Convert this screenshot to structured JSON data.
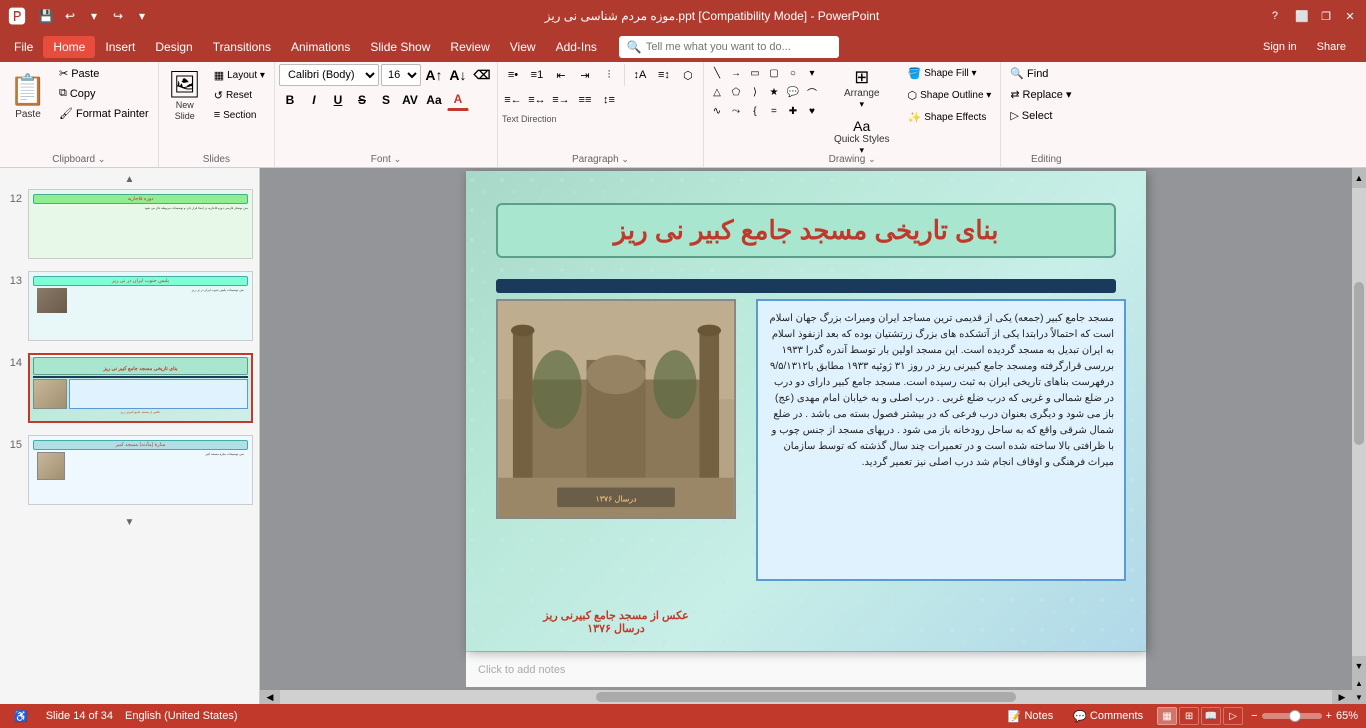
{
  "titlebar": {
    "title": "موزه مردم شناسی نی ریز.ppt [Compatibility Mode] - PowerPoint",
    "quickaccess": [
      "save",
      "undo",
      "redo",
      "customize"
    ]
  },
  "menubar": {
    "items": [
      "File",
      "Home",
      "Insert",
      "Design",
      "Transitions",
      "Animations",
      "Slide Show",
      "Review",
      "View",
      "Add-Ins"
    ],
    "active": "Home",
    "search_placeholder": "Tell me what you want to do...",
    "sign_in": "Sign in",
    "share": "Share"
  },
  "ribbon": {
    "groups": [
      {
        "name": "Clipboard",
        "label": "Clipboard",
        "items": [
          "Paste",
          "Cut",
          "Copy",
          "Format Painter"
        ]
      },
      {
        "name": "Slides",
        "label": "Slides",
        "items": [
          "New Slide",
          "Layout",
          "Reset",
          "Section"
        ]
      },
      {
        "name": "Font",
        "label": "Font",
        "font_name": "Calibri (Body)",
        "font_size": "16",
        "items": [
          "Bold",
          "Italic",
          "Underline",
          "Strikethrough",
          "Shadow",
          "Character Spacing",
          "Change Case",
          "Font Color"
        ]
      },
      {
        "name": "Paragraph",
        "label": "Paragraph",
        "items": [
          "Bullets",
          "Numbering",
          "Decrease Indent",
          "Increase Indent",
          "Align Left",
          "Center",
          "Align Right",
          "Justify",
          "Columns",
          "Text Direction",
          "Align Text",
          "Convert to SmartArt"
        ]
      },
      {
        "name": "Drawing",
        "label": "Drawing",
        "items": [
          "Arrange",
          "Quick Styles",
          "Shape Fill",
          "Shape Outline",
          "Shape Effects",
          "Select"
        ]
      },
      {
        "name": "Editing",
        "label": "Editing",
        "items": [
          "Find",
          "Replace",
          "Select"
        ]
      }
    ],
    "text_direction_label": "Text Direction",
    "align_text_label": "Align Text",
    "convert_smartart_label": "Convert to SmartArt",
    "section_label": "Section",
    "format_painter_label": "Format Painter",
    "copy_label": "Copy",
    "quick_styles_label": "Quick Styles",
    "shape_effects_label": "Shape Effects",
    "select_label": "Select"
  },
  "slides": [
    {
      "number": "12",
      "active": false
    },
    {
      "number": "13",
      "active": false
    },
    {
      "number": "14",
      "active": true
    },
    {
      "number": "15",
      "active": false
    }
  ],
  "current_slide": {
    "title": "بنای تاریخی مسجد جامع کبیر نی ریز",
    "text": "مسجد جامع کبیر (جمعه) یکی از قدیمی ترین مساجد ایران ومیراث بزرگ جهان اسلام است که احتمالاً درابتدا یکی از آتشکده های بزرگ زرتشتیان بوده که بعد ازنفوذ اسلام به ایران تبدیل به مسجد گردیده است. این مسجد اولین بار توسط آندره گدرا ۱۹۳۳ بررسی قرارگرفته ومسجد جامع کبیرنی ریز در روز ۳۱ ژوئیه ۱۹۳۳ مطابق با۹/۵/۱۳۱۲ درفهرست بناهای تاریخی ایران به ثبت رسیده است. مسجد جامع کبیر دارای دو درب در ضلع شمالی و غربی که درب ضلع غربی . درب اصلی و به خیابان امام مهدی (عج) باز می شود و دیگری بعنوان درب فرعی که در بیشتر فصول بسته می باشد . در ضلع شمال شرقی واقع که به ساحل رودخانه باز می شود . دریهای مسجد از جنس چوب و با ظرافتی بالا ساخته شده است و در تعمیرات چند سال گذشته که توسط سازمان میراث فرهنگی و اوقاف انجام شد درب اصلی نیز تعمیر گردید.",
    "image_caption_line1": "عکس از مسجد جامع کبیرنی ریز",
    "image_caption_line2": "درسال ۱۳۷۶"
  },
  "statusbar": {
    "slide_info": "Slide 14 of 34",
    "language": "English (United States)",
    "notes_label": "Notes",
    "comments_label": "Comments",
    "zoom": "65%"
  }
}
